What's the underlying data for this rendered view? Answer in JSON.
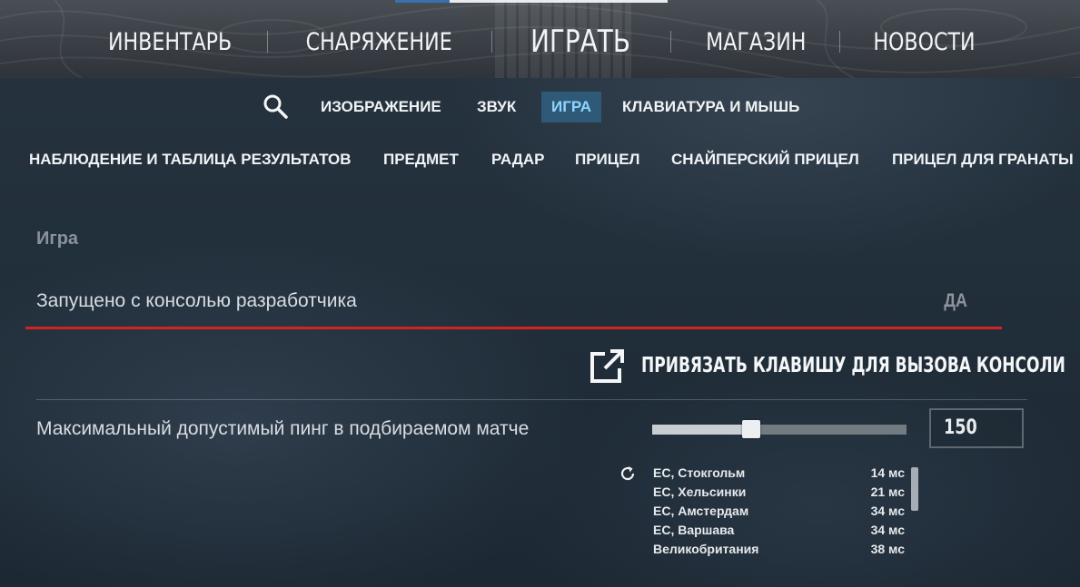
{
  "top_nav": {
    "items": [
      "ИНВЕНТАРЬ",
      "СНАРЯЖЕНИЕ",
      "ИГРАТЬ",
      "МАГАЗИН",
      "НОВОСТИ"
    ],
    "active": "ИГРАТЬ"
  },
  "settings_tabs": {
    "search_icon": "search-icon",
    "items": [
      "ИЗОБРАЖЕНИЕ",
      "ЗВУК",
      "ИГРА",
      "КЛАВИАТУРА И МЫШЬ"
    ],
    "active": "ИГРА"
  },
  "category_tabs": [
    "НАБЛЮДЕНИЕ И ТАБЛИЦА РЕЗУЛЬТАТОВ",
    "ПРЕДМЕТ",
    "РАДАР",
    "ПРИЦЕЛ",
    "СНАЙПЕРСКИЙ ПРИЦЕЛ",
    "ПРИЦЕЛ ДЛЯ ГРАНАТЫ"
  ],
  "section": {
    "title": "Игра",
    "dev_console": {
      "label": "Запущено с консолью разработчика",
      "value": "ДА"
    },
    "bind_console": {
      "icon": "external-link-icon",
      "label": "ПРИВЯЗАТЬ КЛАВИШУ ДЛЯ ВЫЗОВА КОНСОЛИ"
    },
    "max_ping": {
      "label": "Максимальный допустимый пинг в подбираемом матче",
      "slider_fraction": 0.39,
      "value": "150"
    },
    "servers": [
      {
        "name": "ЕС, Стокгольм",
        "ping": "14 мс"
      },
      {
        "name": "ЕС, Хельсинки",
        "ping": "21 мс"
      },
      {
        "name": "ЕС, Амстердам",
        "ping": "34 мс"
      },
      {
        "name": "ЕС, Варшава",
        "ping": "34 мс"
      },
      {
        "name": "Великобритания",
        "ping": "38 мс"
      }
    ]
  },
  "colors": {
    "accent_red": "#d32222",
    "active_tab_bg": "#2f5a77",
    "active_tab_text": "#8fd3ff"
  }
}
